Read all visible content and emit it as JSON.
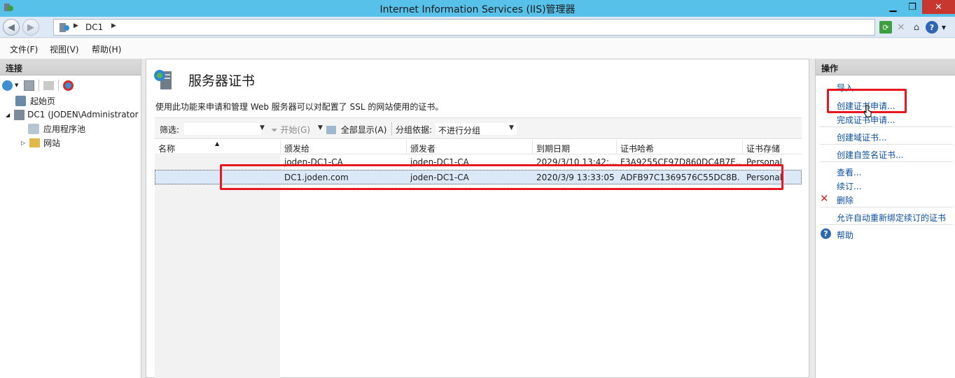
{
  "window": {
    "title": "Internet Information Services (IIS)管理器"
  },
  "address": {
    "crumb": "DC1"
  },
  "menu": {
    "items": [
      "文件(F)",
      "视图(V)",
      "帮助(H)"
    ]
  },
  "connections": {
    "header": "连接",
    "tree": [
      {
        "label": "起始页"
      },
      {
        "label": "DC1 (JODEN\\Administrator"
      },
      {
        "label": "应用程序池"
      },
      {
        "label": "网站"
      }
    ]
  },
  "main": {
    "title": "服务器证书",
    "description": "使用此功能来申请和管理 Web 服务器可以对配置了 SSL 的网站使用的证书。",
    "filter": {
      "label": "筛选:",
      "start_label": "开始(G)",
      "show_all_label": "全部显示(A)",
      "group_by_label": "分组依据:",
      "group_by_value": "不进行分组"
    },
    "columns": [
      "名称",
      "颁发给",
      "颁发者",
      "到期日期",
      "证书哈希",
      "证书存储"
    ],
    "rows": [
      {
        "name": "",
        "issued_to": "joden-DC1-CA",
        "issuer": "joden-DC1-CA",
        "expires": "2029/3/10 13:42:...",
        "hash": "F3A9255CF97D860DC4B7E...",
        "store": "Personal"
      },
      {
        "name": "",
        "issued_to": "DC1.joden.com",
        "issuer": "joden-DC1-CA",
        "expires": "2020/3/9 13:33:05",
        "hash": "ADFB97C1369576C55DC8B...",
        "store": "Personal"
      }
    ]
  },
  "actions": {
    "header": "操作",
    "import": "导入...",
    "create_request": "创建证书申请...",
    "complete_request": "完成证书申请...",
    "create_domain_cert": "创建域证书...",
    "create_self_signed": "创建自签名证书...",
    "view": "查看...",
    "renew": "续订...",
    "delete": "删除",
    "auto_rebind": "允许自动重新绑定续订的证书",
    "help": "帮助"
  },
  "colors": {
    "titlebar": "#57c1ea",
    "link": "#0c4fa0",
    "highlight_box": "#e8161e",
    "selected_row": "#dbe8f7"
  }
}
